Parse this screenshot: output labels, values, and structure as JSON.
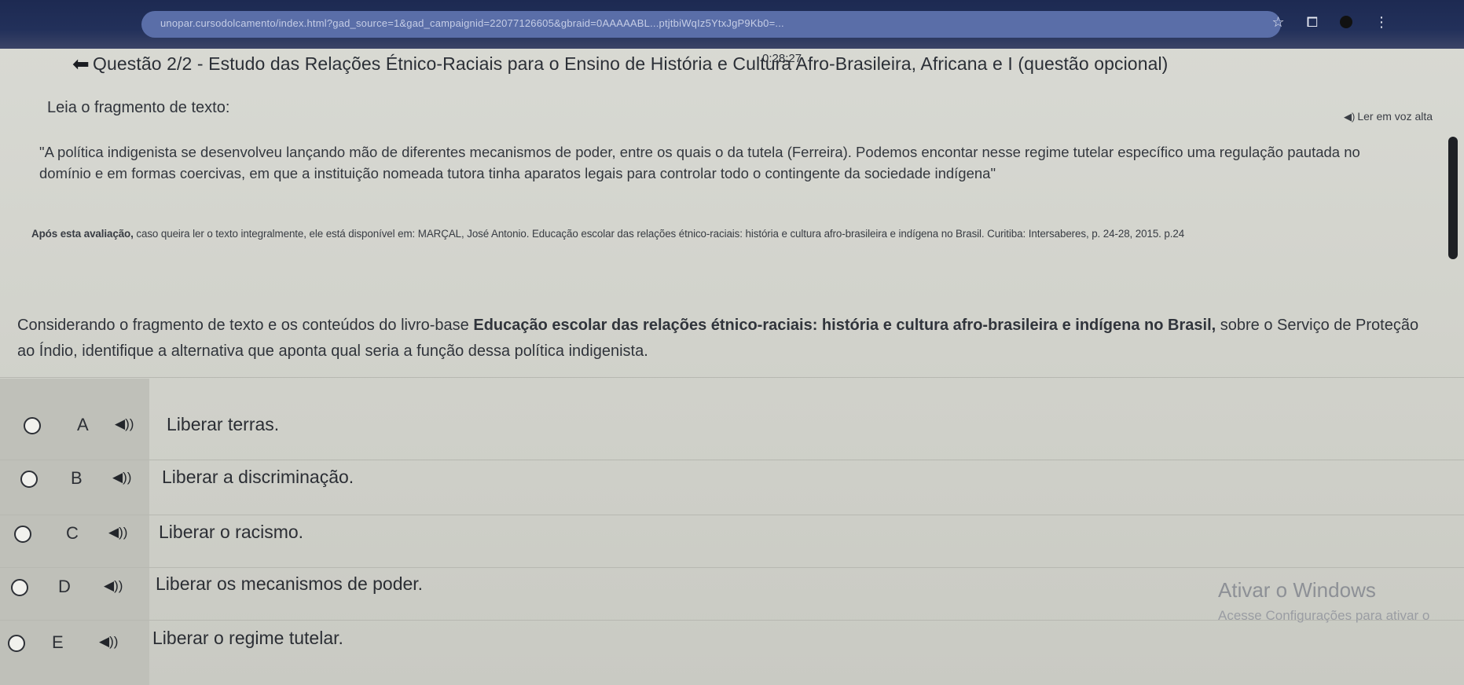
{
  "browser": {
    "url": "unopar.cursodolcamento/index.html?gad_source=1&gad_campaignid=22077126605&gbraid=0AAAAABL...ptjtbiWqIz5YtxJgP9Kb0=..."
  },
  "header": {
    "timer": "0:28:27",
    "title": "Questão 2/2 - Estudo das Relações Étnico-Raciais para o Ensino de História e Cultura Afro-Brasileira, Africana e I (questão opcional)",
    "read_aloud": "Ler em voz alta"
  },
  "content": {
    "lead": "Leia o fragmento de texto:",
    "quote": "\"A política indigenista se desenvolveu lançando mão de diferentes mecanismos de poder, entre os quais o da tutela (Ferreira). Podemos encontar nesse regime tutelar específico uma regulação pautada no domínio e em formas coercivas, em que a instituição nomeada tutora tinha aparatos legais para controlar todo o contingente da sociedade indígena\"",
    "after_eval_bold": "Após esta avaliação,",
    "after_eval_rest": " caso queira ler o texto integralmente, ele está disponível em: MARÇAL, José Antonio. Educação escolar das relações étnico-raciais: história e cultura afro-brasileira e indígena no Brasil. Curitiba: Intersaberes, p. 24-28, 2015. p.24",
    "consider_pre": "Considerando o fragmento de texto e os conteúdos do livro-base ",
    "consider_bold": "Educação escolar das relações étnico-raciais: história e cultura afro-brasileira e indígena no Brasil,",
    "consider_post": " sobre o Serviço de Proteção ao Índio, identifique a alternativa que aponta qual seria a função dessa política indigenista."
  },
  "options": [
    {
      "letter": "A",
      "text": "Liberar terras."
    },
    {
      "letter": "B",
      "text": "Liberar a discriminação."
    },
    {
      "letter": "C",
      "text": "Liberar o racismo."
    },
    {
      "letter": "D",
      "text": "Liberar os mecanismos de poder."
    },
    {
      "letter": "E",
      "text": "Liberar o regime tutelar."
    }
  ],
  "watermark": {
    "title": "Ativar o Windows",
    "subtitle": "Acesse Configurações para ativar o"
  },
  "icons": {
    "back": "arrow-left-icon",
    "speaker": "speaker-icon",
    "star": "star-icon",
    "extension": "puzzle-icon",
    "menu": "kebab-menu-icon"
  }
}
